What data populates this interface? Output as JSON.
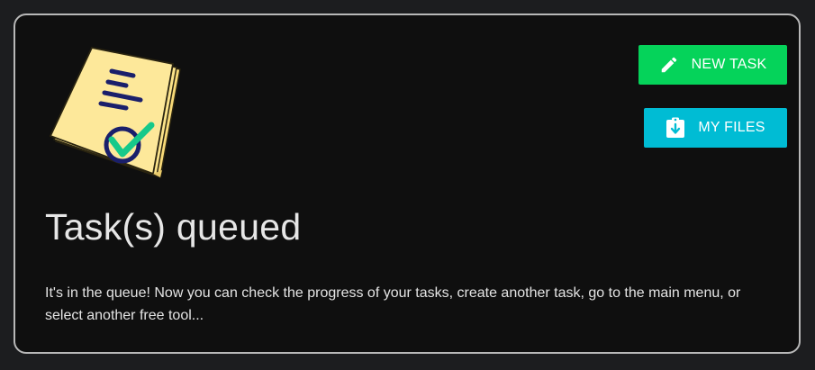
{
  "buttons": {
    "new_task": "NEW TASK",
    "my_files": "MY FILES"
  },
  "status": {
    "title": "Task(s) queued",
    "message": "It's in the queue! Now you can check the progress of your tasks, create another task, go to the main menu, or select another free tool..."
  },
  "icons": {
    "illustration": "notes-checkmark-icon",
    "new_task": "pencil-icon",
    "my_files": "clipboard-download-icon"
  },
  "colors": {
    "background": "#1c1d1f",
    "card": "#0f0f0f",
    "new_task_button": "#05d35a",
    "my_files_button": "#00bcd4",
    "paper": "#fde58f",
    "check": "#16c98a",
    "text": "#e6e6e6"
  }
}
